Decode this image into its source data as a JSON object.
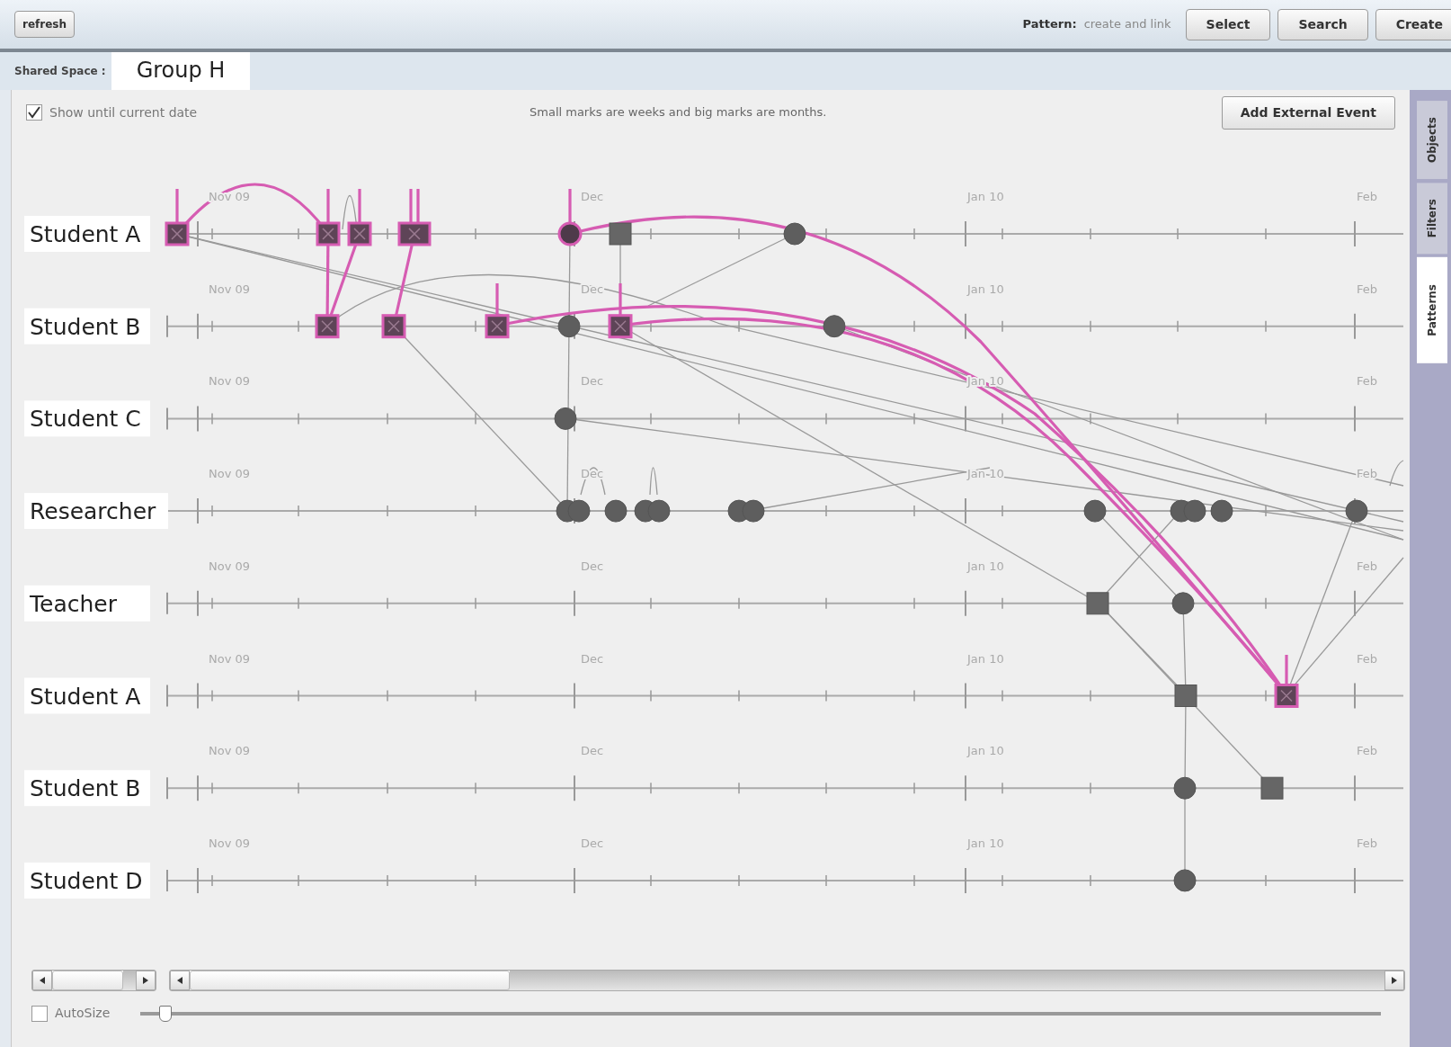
{
  "toolbar": {
    "refresh": "refresh",
    "pattern_label": "Pattern:",
    "pattern_value": "create and link",
    "buttons": [
      "Select",
      "Search",
      "Create"
    ]
  },
  "space": {
    "label": "Shared Space :",
    "tabs": [
      {
        "label": "Group H",
        "selected": true
      }
    ]
  },
  "options": {
    "show_until_current": {
      "label": "Show until current date",
      "checked": true
    },
    "note": "Small marks are weeks and big marks are months.",
    "add_button": "Add External Event"
  },
  "side_tabs": [
    {
      "label": "Objects",
      "selected": false
    },
    {
      "label": "Filters",
      "selected": false
    },
    {
      "label": "Patterns",
      "selected": true
    }
  ],
  "lanes": [
    {
      "label": "Student A",
      "month_labels": [
        "Nov 09",
        "Dec",
        "Jan 10",
        "Feb"
      ],
      "events": [
        {
          "kind": "square",
          "highlighted": true
        },
        {
          "kind": "square",
          "highlighted": true
        },
        {
          "kind": "square",
          "highlighted": true
        },
        {
          "kind": "square",
          "highlighted": true
        },
        {
          "kind": "circle",
          "highlighted": true
        },
        {
          "kind": "square",
          "highlighted": false
        },
        {
          "kind": "circle",
          "highlighted": false
        }
      ]
    },
    {
      "label": "Student B",
      "month_labels": [
        "Nov 09",
        "Dec",
        "Jan 10",
        "Feb"
      ],
      "events": [
        {
          "kind": "square",
          "highlighted": true
        },
        {
          "kind": "square",
          "highlighted": true
        },
        {
          "kind": "square",
          "highlighted": true
        },
        {
          "kind": "circle",
          "highlighted": false
        },
        {
          "kind": "square",
          "highlighted": true
        },
        {
          "kind": "circle",
          "highlighted": false
        }
      ]
    },
    {
      "label": "Student C",
      "month_labels": [
        "Nov 09",
        "Dec",
        "Jan 10",
        "Feb"
      ],
      "events": [
        {
          "kind": "circle",
          "highlighted": false
        }
      ]
    },
    {
      "label": "Researcher",
      "month_labels": [
        "Nov 09",
        "Dec",
        "Jan 10",
        "Feb"
      ],
      "events": [
        {
          "kind": "circle",
          "highlighted": false
        },
        {
          "kind": "circle",
          "highlighted": false
        },
        {
          "kind": "circle",
          "highlighted": false
        },
        {
          "kind": "circle",
          "highlighted": false
        },
        {
          "kind": "circle",
          "highlighted": false
        },
        {
          "kind": "circle",
          "highlighted": false
        },
        {
          "kind": "circle",
          "highlighted": false
        },
        {
          "kind": "circle",
          "highlighted": false
        },
        {
          "kind": "circle",
          "highlighted": false
        },
        {
          "kind": "circle",
          "highlighted": false
        },
        {
          "kind": "circle",
          "highlighted": false
        },
        {
          "kind": "circle",
          "highlighted": false
        }
      ]
    },
    {
      "label": "Teacher",
      "month_labels": [
        "Nov 09",
        "Dec",
        "Jan 10",
        "Feb"
      ],
      "events": [
        {
          "kind": "square",
          "highlighted": false
        },
        {
          "kind": "circle",
          "highlighted": false
        }
      ]
    },
    {
      "label": "Student A",
      "month_labels": [
        "Nov 09",
        "Dec",
        "Jan 10",
        "Feb"
      ],
      "events": [
        {
          "kind": "square",
          "highlighted": false
        },
        {
          "kind": "square",
          "highlighted": true
        }
      ]
    },
    {
      "label": "Student B",
      "month_labels": [
        "Nov 09",
        "Dec",
        "Jan 10",
        "Feb"
      ],
      "events": [
        {
          "kind": "circle",
          "highlighted": false
        },
        {
          "kind": "square",
          "highlighted": false
        }
      ]
    },
    {
      "label": "Student D",
      "month_labels": [
        "Nov 09",
        "Dec",
        "Jan 10",
        "Feb"
      ],
      "events": [
        {
          "kind": "circle",
          "highlighted": false
        }
      ]
    }
  ],
  "autosize": {
    "label": "AutoSize",
    "checked": false
  },
  "zoom_slider": {
    "level": 0.02
  }
}
